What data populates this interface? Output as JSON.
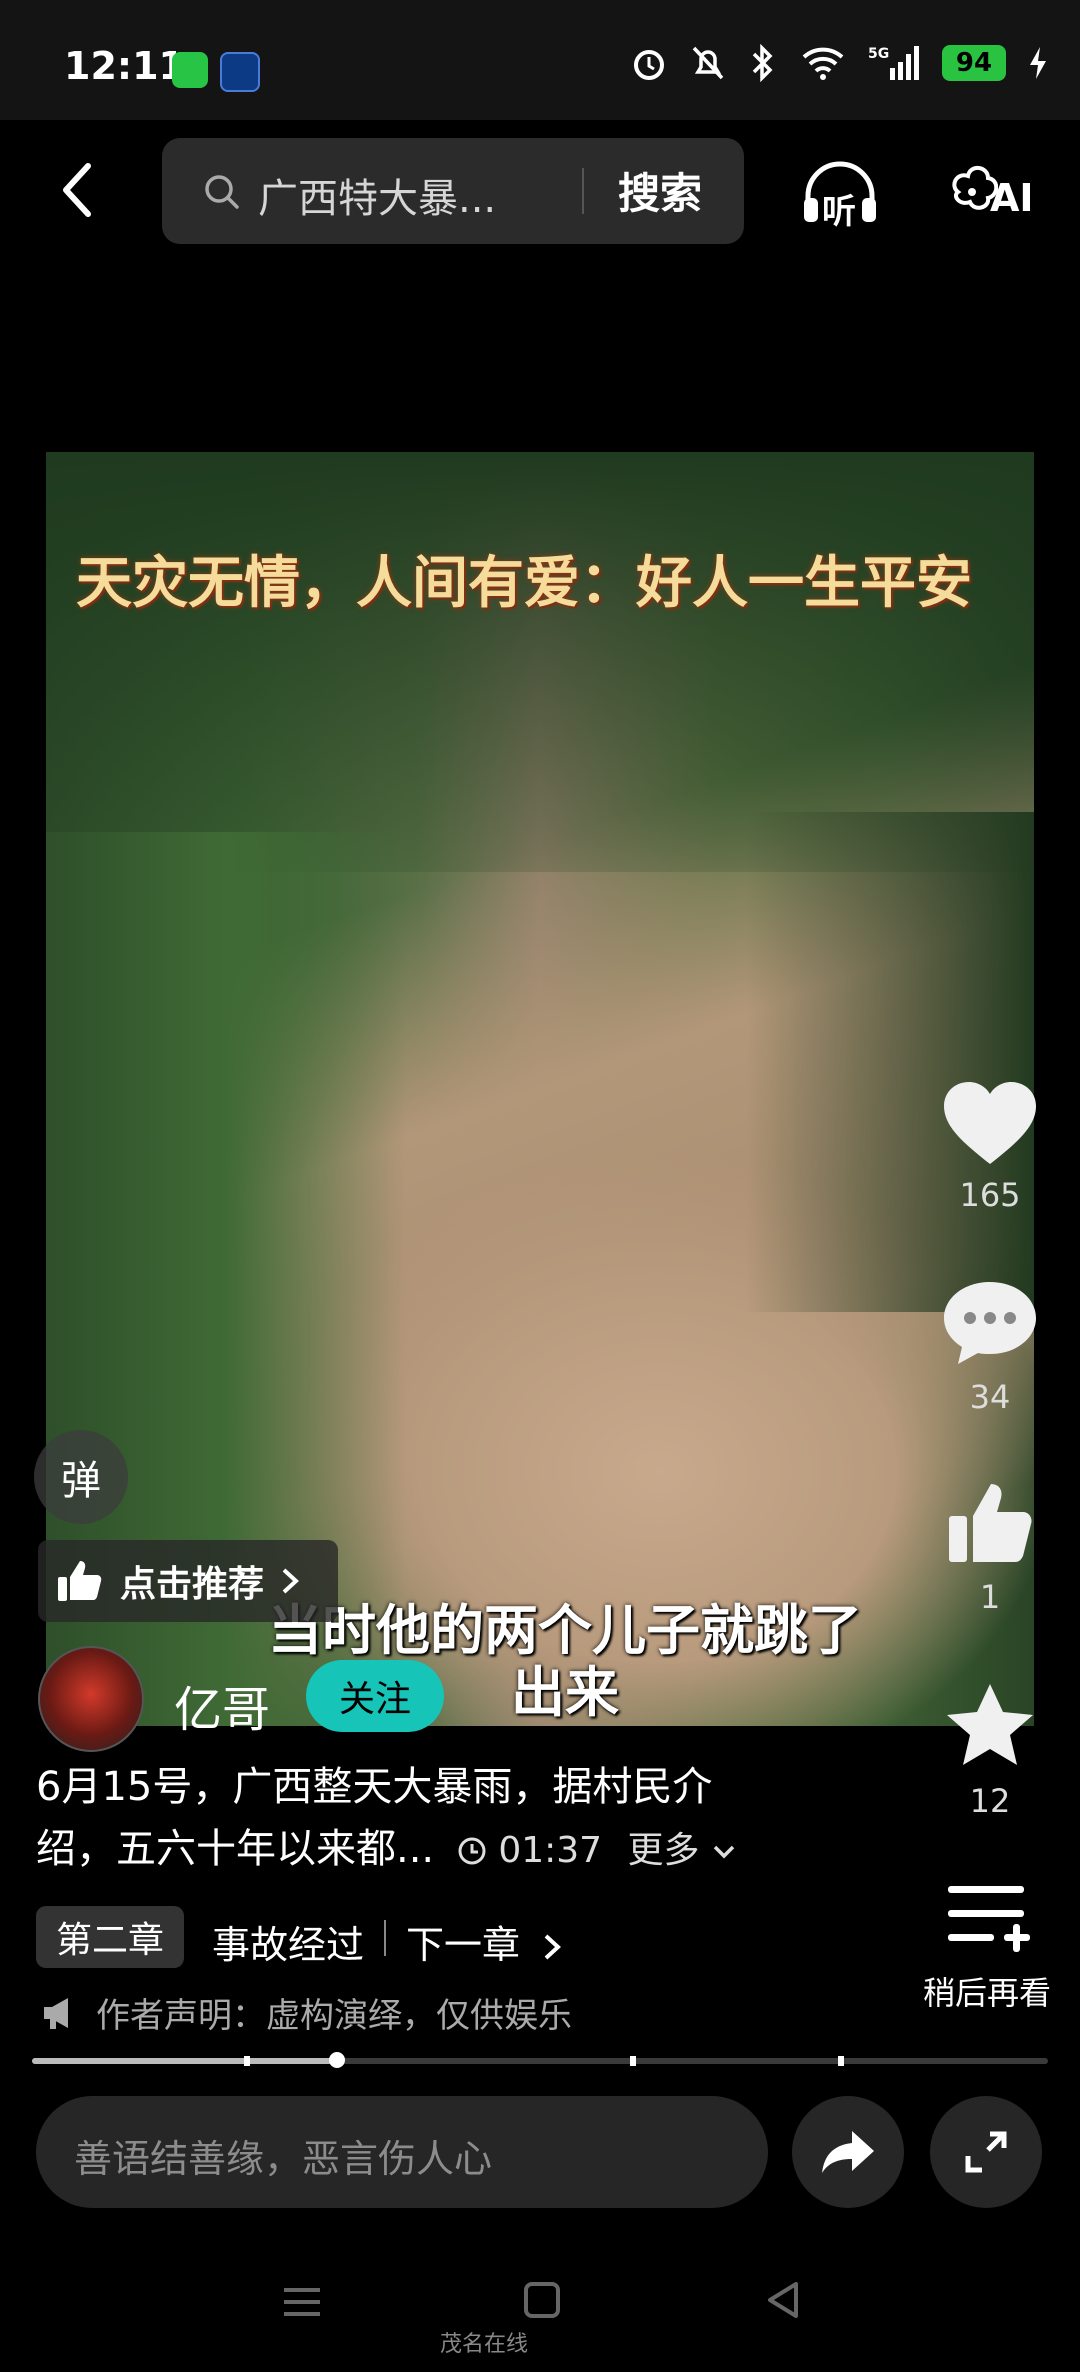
{
  "status_bar": {
    "time": "12:11",
    "network": "5G",
    "battery": "94"
  },
  "header": {
    "search_query": "广西特大暴...",
    "search_button": "搜索",
    "listen_label": "听",
    "ai_label": "AI"
  },
  "video": {
    "overlay_title": "天灾无情，人间有爱：好人一生平安",
    "subtitle_line1": "当时他的两个儿子就跳了",
    "subtitle_line2": "出来"
  },
  "rail": {
    "likes": "165",
    "comments": "34",
    "thumbs": "1",
    "favorites": "12",
    "watch_later": "稍后再看"
  },
  "danmu_label": "弹",
  "recommend_label": "点击推荐",
  "author": {
    "name": "亿哥",
    "follow_label": "关注"
  },
  "description": {
    "line1": "6月15号，广西整天大暴雨，据村民介",
    "line2": "绍，五六十年以来都...",
    "duration": "01:37",
    "more_label": "更多"
  },
  "chapter": {
    "badge": "第二章",
    "title": "事故经过",
    "next": "下一章"
  },
  "notice": "作者声明：虚构演绎，仅供娱乐",
  "progress": {
    "played_fraction": 0.3
  },
  "comment": {
    "placeholder": "善语结善缘，恶言伤人心"
  },
  "watermark": "茂名在线"
}
